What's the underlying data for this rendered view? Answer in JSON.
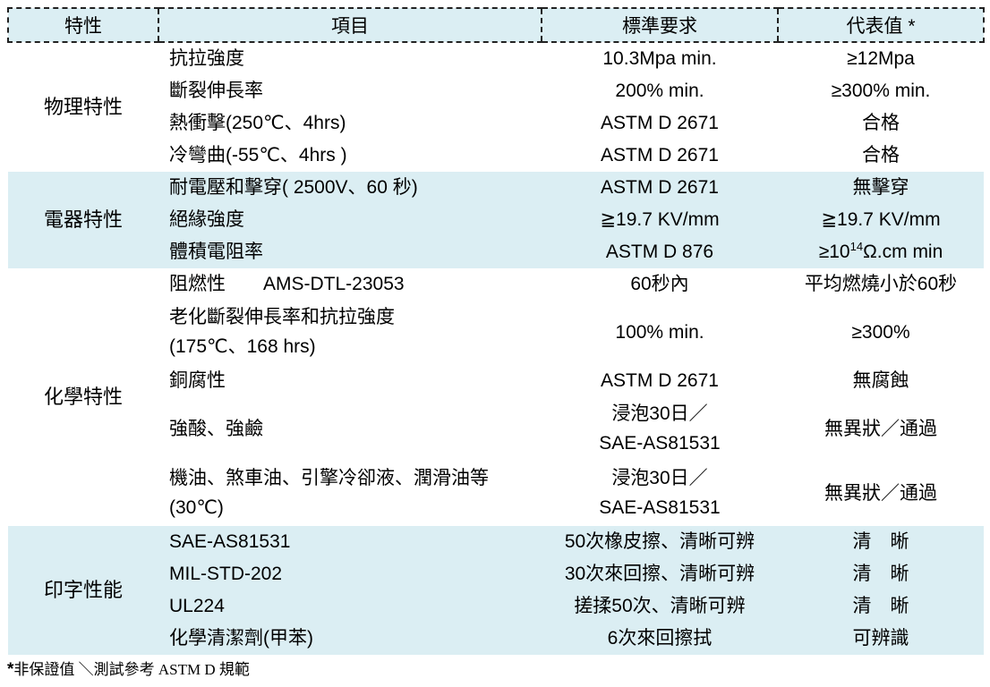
{
  "header": {
    "col1": "特性",
    "col2": "項目",
    "col3": "標準要求",
    "col4": "代表值 *"
  },
  "groups": {
    "physical": {
      "name": "物理特性",
      "rows": [
        {
          "item": "抗拉強度",
          "std": "10.3Mpa min.",
          "val": "≥12Mpa"
        },
        {
          "item": "斷裂伸長率",
          "std": "200% min.",
          "val": "≥300% min."
        },
        {
          "item": "熱衝擊(250℃、4hrs)",
          "std": "ASTM D 2671",
          "val": "合格"
        },
        {
          "item": "冷彎曲(-55℃、4hrs )",
          "std": "ASTM D 2671",
          "val": "合格"
        }
      ]
    },
    "electrical": {
      "name": "電器特性",
      "rows": [
        {
          "item": "耐電壓和擊穿( 2500V、60 秒)",
          "std": "ASTM D 2671",
          "val": "無擊穿"
        },
        {
          "item": "絕緣強度",
          "std": "≧19.7 KV/mm",
          "val": "≧19.7 KV/mm"
        },
        {
          "item": "體積電阻率",
          "std": "ASTM D 876",
          "val_pre": "≥10",
          "val_sup": "14",
          "val_post": "Ω.cm min"
        }
      ]
    },
    "chemical": {
      "name": "化學特性",
      "rows": [
        {
          "item": "阻燃性　　AMS-DTL-23053",
          "std": "60秒內",
          "val": "平均燃燒小於60秒"
        },
        {
          "item_line1": "老化斷裂伸長率和抗拉強度",
          "item_line2": "(175℃、168 hrs)",
          "std": "100% min.",
          "val": "≥300%"
        },
        {
          "item": "銅腐性",
          "std": "ASTM D 2671",
          "val": "無腐蝕"
        },
        {
          "item": "強酸、強鹼",
          "std_line1": "浸泡30日／",
          "std_line2": "SAE-AS81531",
          "val": "無異狀／通過"
        },
        {
          "item_line1": "機油、煞車油、引擎冷卻液、潤滑油等",
          "item_line2": "(30℃)",
          "std_line1": "浸泡30日／",
          "std_line2": "SAE-AS81531",
          "val": "無異狀／通過"
        }
      ]
    },
    "marking": {
      "name": "印字性能",
      "rows": [
        {
          "item": "SAE-AS81531",
          "std": "50次橡皮擦、清晰可辨",
          "val": "清　晰"
        },
        {
          "item": "MIL-STD-202",
          "std": "30次來回擦、清晰可辨",
          "val": "清　晰"
        },
        {
          "item": "UL224",
          "std": "搓揉50次、清晰可辨",
          "val": "清　晰"
        },
        {
          "item": "化學清潔劑(甲苯)",
          "std": "6次來回擦拭",
          "val": "可辨識"
        }
      ]
    }
  },
  "footnote": {
    "star": "*",
    "text": "非保證值 ＼測試參考 ASTM D 規範"
  }
}
